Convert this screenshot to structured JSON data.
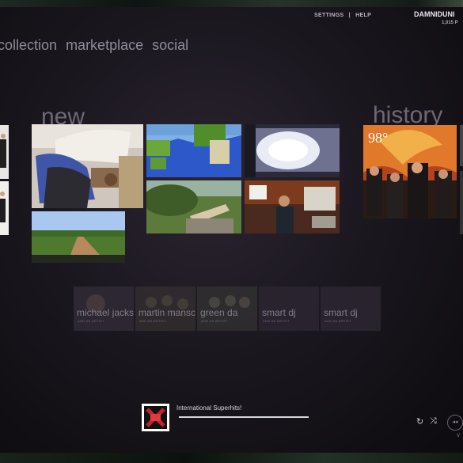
{
  "header": {
    "settings_label": "SETTINGS",
    "separator": "|",
    "help_label": "HELP",
    "username": "DAMNIDUNI",
    "points": "1,015 P"
  },
  "nav": {
    "items": [
      "collection",
      "marketplace",
      "social"
    ]
  },
  "sections": {
    "new_title": "new",
    "history_title": "history"
  },
  "history": {
    "album_title": "98°"
  },
  "pins": [
    {
      "label": "michael jackson",
      "sub": "ADD AN ARTIST"
    },
    {
      "label": "martin mansc",
      "sub": "ADD AN ARTIST"
    },
    {
      "label": "green da",
      "sub": "ADD AN ARTIST"
    },
    {
      "label": "smart dj",
      "sub": "ADD AN ARTIST"
    },
    {
      "label": "smart dj",
      "sub": "ADD AN ARTIST"
    }
  ],
  "now_playing": {
    "title": "International Superhits!",
    "progress_fraction": 1.0
  },
  "controls": {
    "repeat_icon": "↻",
    "shuffle_icon": "⤨",
    "prev_icon": "◂◂",
    "volume_label": "V"
  }
}
